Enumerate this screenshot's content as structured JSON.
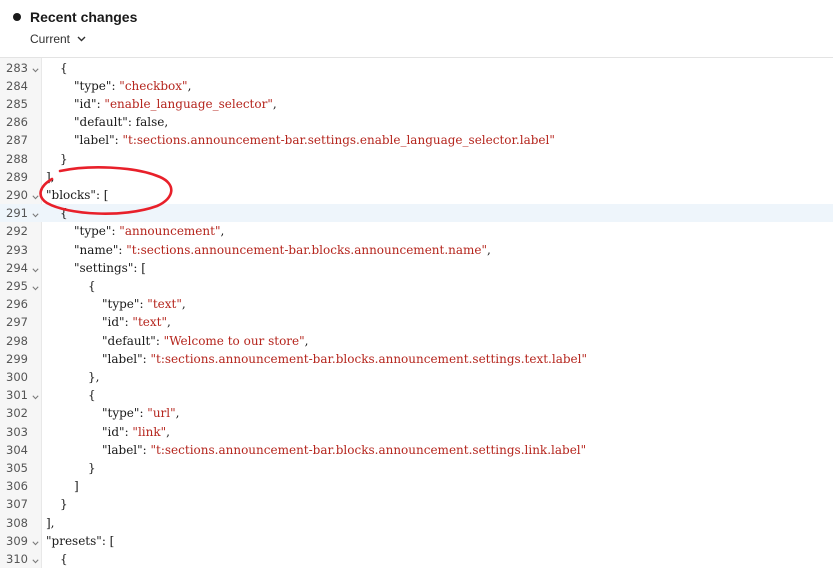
{
  "header": {
    "title": "Recent changes",
    "version_label": "Current"
  },
  "editor": {
    "lines": [
      {
        "n": "283",
        "fold": true,
        "indent": 2,
        "parts": [
          [
            "p",
            "{"
          ]
        ]
      },
      {
        "n": "284",
        "fold": false,
        "indent": 3,
        "parts": [
          [
            "k",
            "\"type\""
          ],
          [
            "p",
            ": "
          ],
          [
            "s",
            "\"checkbox\""
          ],
          [
            "p",
            ","
          ]
        ]
      },
      {
        "n": "285",
        "fold": false,
        "indent": 3,
        "parts": [
          [
            "k",
            "\"id\""
          ],
          [
            "p",
            ": "
          ],
          [
            "s",
            "\"enable_language_selector\""
          ],
          [
            "p",
            ","
          ]
        ]
      },
      {
        "n": "286",
        "fold": false,
        "indent": 3,
        "parts": [
          [
            "k",
            "\"default\""
          ],
          [
            "p",
            ": false,"
          ]
        ]
      },
      {
        "n": "287",
        "fold": false,
        "indent": 3,
        "parts": [
          [
            "k",
            "\"label\""
          ],
          [
            "p",
            ": "
          ],
          [
            "s",
            "\"t:sections.announcement-bar.settings.enable_language_selector.label\""
          ]
        ]
      },
      {
        "n": "288",
        "fold": false,
        "indent": 2,
        "parts": [
          [
            "p",
            "}"
          ]
        ]
      },
      {
        "n": "289",
        "fold": false,
        "indent": 1,
        "parts": [
          [
            "p",
            "],"
          ]
        ]
      },
      {
        "n": "290",
        "fold": true,
        "indent": 1,
        "parts": [
          [
            "k",
            "\"blocks\""
          ],
          [
            "p",
            ": ["
          ]
        ]
      },
      {
        "n": "291",
        "fold": true,
        "indent": 2,
        "parts": [
          [
            "p",
            "{"
          ]
        ],
        "active": true
      },
      {
        "n": "292",
        "fold": false,
        "indent": 3,
        "parts": [
          [
            "k",
            "\"type\""
          ],
          [
            "p",
            ": "
          ],
          [
            "s",
            "\"announcement\""
          ],
          [
            "p",
            ","
          ]
        ]
      },
      {
        "n": "293",
        "fold": false,
        "indent": 3,
        "parts": [
          [
            "k",
            "\"name\""
          ],
          [
            "p",
            ": "
          ],
          [
            "s",
            "\"t:sections.announcement-bar.blocks.announcement.name\""
          ],
          [
            "p",
            ","
          ]
        ]
      },
      {
        "n": "294",
        "fold": true,
        "indent": 3,
        "parts": [
          [
            "k",
            "\"settings\""
          ],
          [
            "p",
            ": ["
          ]
        ]
      },
      {
        "n": "295",
        "fold": true,
        "indent": 4,
        "parts": [
          [
            "p",
            "{"
          ]
        ]
      },
      {
        "n": "296",
        "fold": false,
        "indent": 5,
        "parts": [
          [
            "k",
            "\"type\""
          ],
          [
            "p",
            ": "
          ],
          [
            "s",
            "\"text\""
          ],
          [
            "p",
            ","
          ]
        ]
      },
      {
        "n": "297",
        "fold": false,
        "indent": 5,
        "parts": [
          [
            "k",
            "\"id\""
          ],
          [
            "p",
            ": "
          ],
          [
            "s",
            "\"text\""
          ],
          [
            "p",
            ","
          ]
        ]
      },
      {
        "n": "298",
        "fold": false,
        "indent": 5,
        "parts": [
          [
            "k",
            "\"default\""
          ],
          [
            "p",
            ": "
          ],
          [
            "s",
            "\"Welcome to our store\""
          ],
          [
            "p",
            ","
          ]
        ]
      },
      {
        "n": "299",
        "fold": false,
        "indent": 5,
        "parts": [
          [
            "k",
            "\"label\""
          ],
          [
            "p",
            ": "
          ],
          [
            "s",
            "\"t:sections.announcement-bar.blocks.announcement.settings.text.label\""
          ]
        ]
      },
      {
        "n": "300",
        "fold": false,
        "indent": 4,
        "parts": [
          [
            "p",
            "},"
          ]
        ]
      },
      {
        "n": "301",
        "fold": true,
        "indent": 4,
        "parts": [
          [
            "p",
            "{"
          ]
        ]
      },
      {
        "n": "302",
        "fold": false,
        "indent": 5,
        "parts": [
          [
            "k",
            "\"type\""
          ],
          [
            "p",
            ": "
          ],
          [
            "s",
            "\"url\""
          ],
          [
            "p",
            ","
          ]
        ]
      },
      {
        "n": "303",
        "fold": false,
        "indent": 5,
        "parts": [
          [
            "k",
            "\"id\""
          ],
          [
            "p",
            ": "
          ],
          [
            "s",
            "\"link\""
          ],
          [
            "p",
            ","
          ]
        ]
      },
      {
        "n": "304",
        "fold": false,
        "indent": 5,
        "parts": [
          [
            "k",
            "\"label\""
          ],
          [
            "p",
            ": "
          ],
          [
            "s",
            "\"t:sections.announcement-bar.blocks.announcement.settings.link.label\""
          ]
        ]
      },
      {
        "n": "305",
        "fold": false,
        "indent": 4,
        "parts": [
          [
            "p",
            "}"
          ]
        ]
      },
      {
        "n": "306",
        "fold": false,
        "indent": 3,
        "parts": [
          [
            "p",
            "]"
          ]
        ]
      },
      {
        "n": "307",
        "fold": false,
        "indent": 2,
        "parts": [
          [
            "p",
            "}"
          ]
        ]
      },
      {
        "n": "308",
        "fold": false,
        "indent": 1,
        "parts": [
          [
            "p",
            "],"
          ]
        ]
      },
      {
        "n": "309",
        "fold": true,
        "indent": 1,
        "parts": [
          [
            "k",
            "\"presets\""
          ],
          [
            "p",
            ": ["
          ]
        ]
      },
      {
        "n": "310",
        "fold": true,
        "indent": 2,
        "parts": [
          [
            "p",
            "{"
          ]
        ]
      }
    ]
  },
  "colors": {
    "string": "#b5251d",
    "text": "#1a1a1a",
    "annotation": "#e8202a",
    "active_line": "#eef5fb"
  }
}
